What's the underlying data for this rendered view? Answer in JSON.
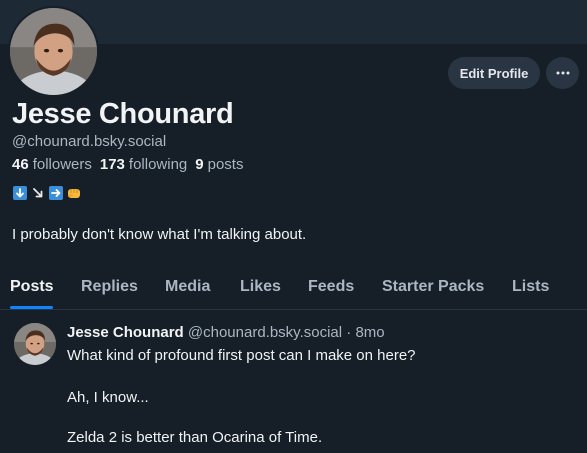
{
  "colors": {
    "background": "#161e27",
    "banner": "#1e2936",
    "button_bg": "#2a3543",
    "text_primary": "#f1f3f5",
    "text_secondary": "#aab6c2",
    "accent": "#1083fe"
  },
  "profile": {
    "display_name": "Jesse Chounard",
    "handle": "@chounard.bsky.social",
    "stats": {
      "followers_count": "46",
      "followers_label": "followers",
      "following_count": "173",
      "following_label": "following",
      "posts_count": "9",
      "posts_label": "posts"
    },
    "emoji_icons": [
      "down-arrow-icon",
      "down-right-arrow-icon",
      "right-arrow-icon",
      "fist-bump-icon"
    ],
    "bio": "I probably don't know what I'm talking about."
  },
  "actions": {
    "edit_profile_label": "Edit Profile",
    "more_icon": "ellipsis-icon"
  },
  "tabs": [
    {
      "label": "Posts",
      "active": true
    },
    {
      "label": "Replies",
      "active": false
    },
    {
      "label": "Media",
      "active": false
    },
    {
      "label": "Likes",
      "active": false
    },
    {
      "label": "Feeds",
      "active": false
    },
    {
      "label": "Starter Packs",
      "active": false
    },
    {
      "label": "Lists",
      "active": false
    }
  ],
  "post": {
    "author": "Jesse Chounard",
    "handle": "@chounard.bsky.social",
    "separator": "·",
    "time": "8mo",
    "lines": [
      "What kind of profound first post can I make on here?",
      "Ah, I know...",
      "Zelda 2 is better than Ocarina of Time."
    ]
  }
}
